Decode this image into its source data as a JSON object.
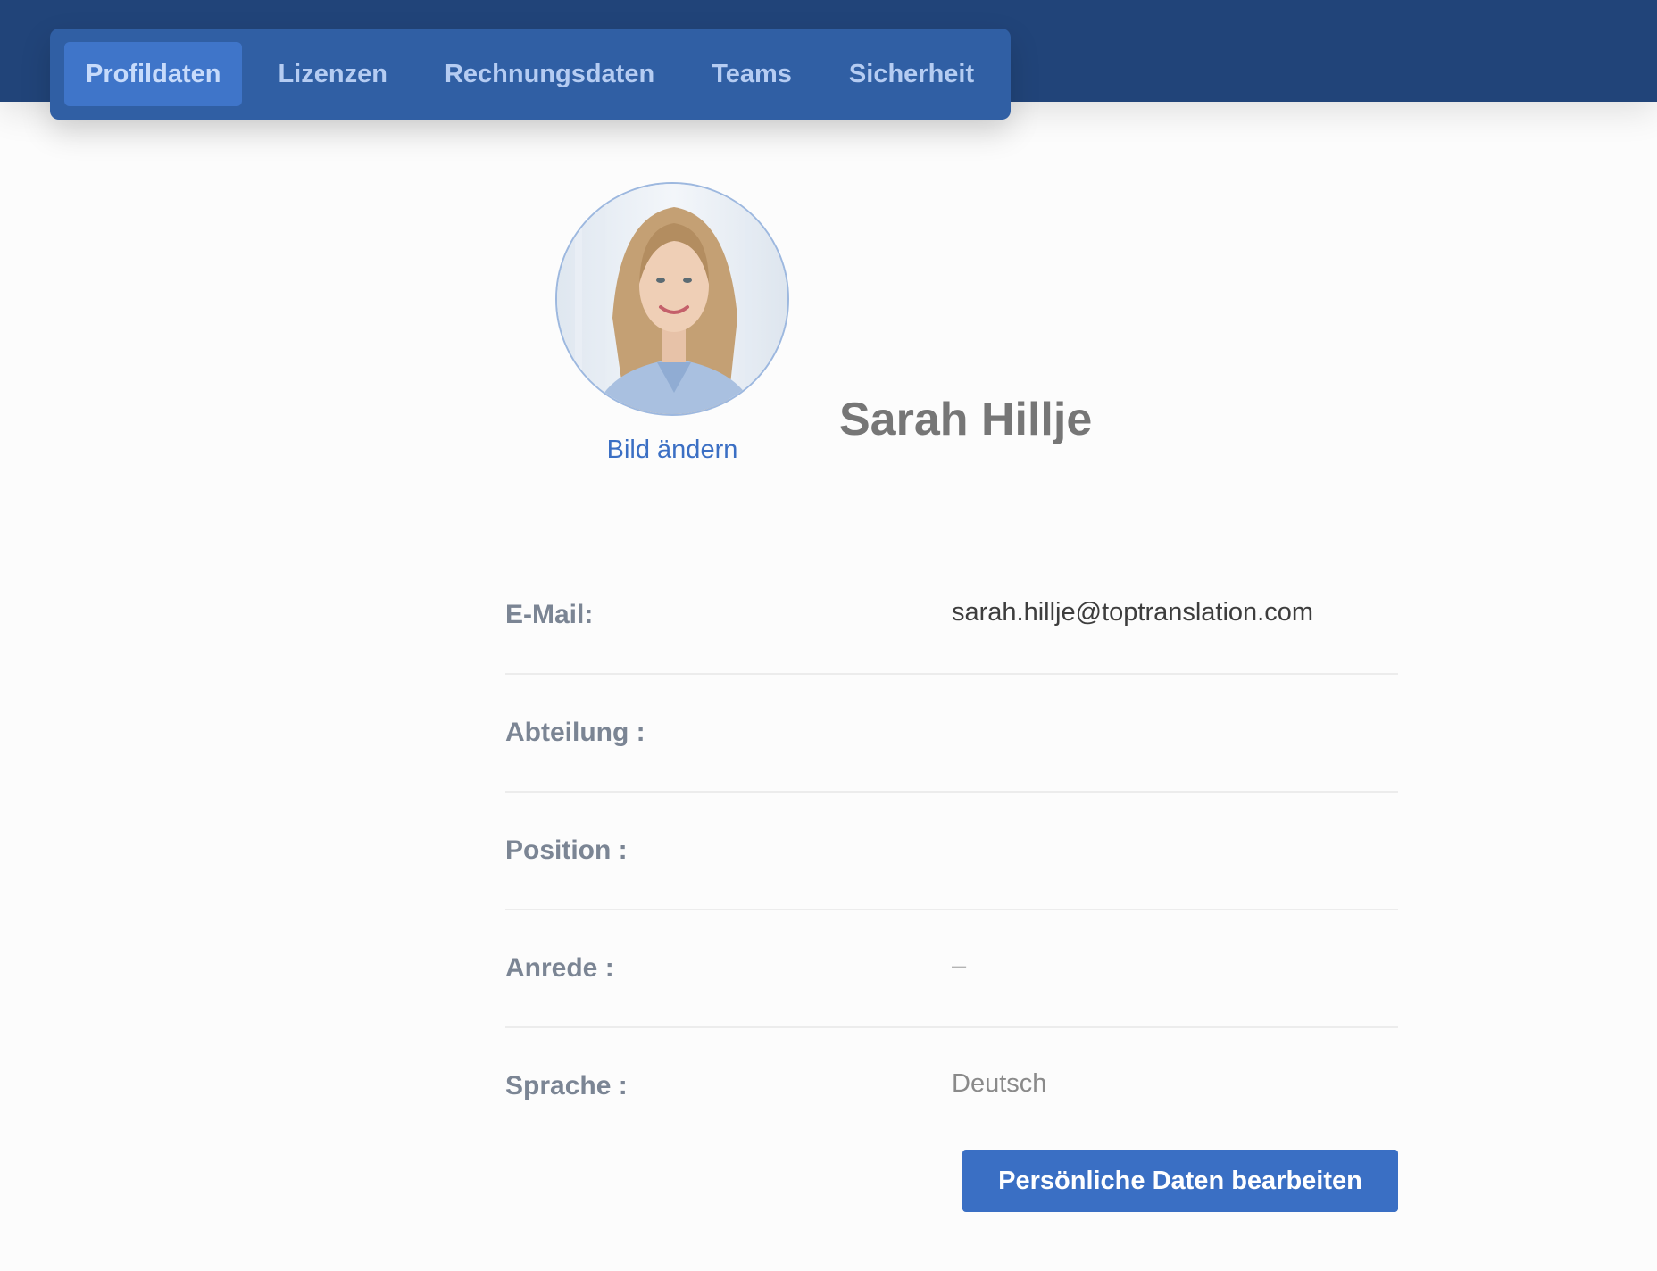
{
  "nav": {
    "tabs": [
      {
        "label": "Profildaten",
        "active": true
      },
      {
        "label": "Lizenzen",
        "active": false
      },
      {
        "label": "Rechnungsdaten",
        "active": false
      },
      {
        "label": "Teams",
        "active": false
      },
      {
        "label": "Sicherheit",
        "active": false
      }
    ]
  },
  "profile": {
    "change_picture_label": "Bild ändern",
    "name": "Sarah Hillje"
  },
  "fields": [
    {
      "label": "E-Mail:",
      "value": "sarah.hillje@toptranslation.com"
    },
    {
      "label": "Abteilung :",
      "value": ""
    },
    {
      "label": "Position :",
      "value": ""
    },
    {
      "label": "Anrede :",
      "value": "–"
    },
    {
      "label": "Sprache :",
      "value": "Deutsch"
    }
  ],
  "actions": {
    "edit_label": "Persönliche Daten bearbeiten"
  },
  "colors": {
    "header_bg": "#214479",
    "tabbar_bg": "#305fa4",
    "tab_active_bg": "#3f75c9",
    "accent": "#3a6fc4"
  }
}
